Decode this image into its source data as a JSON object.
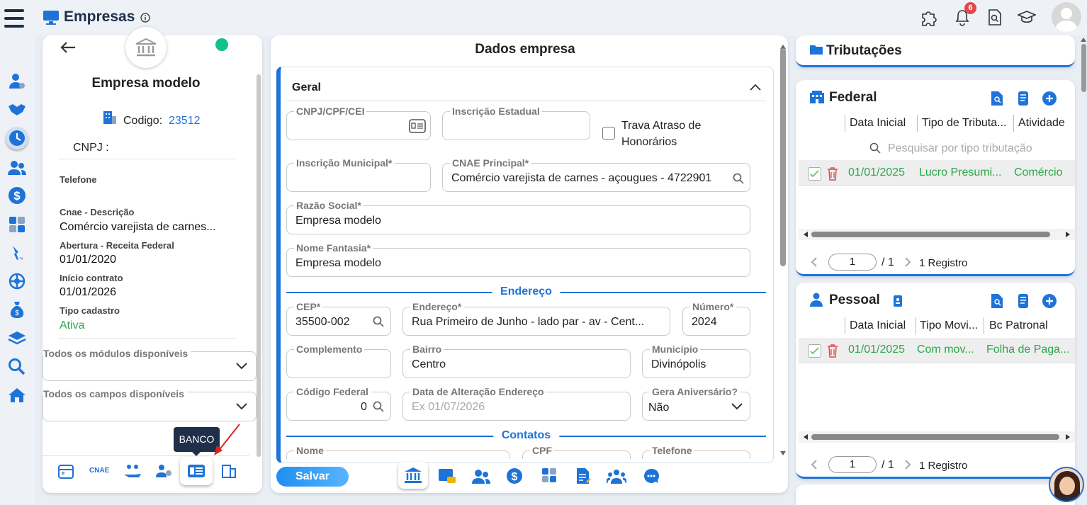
{
  "header": {
    "title": "Empresas",
    "notification_count": "6"
  },
  "company": {
    "name": "Empresa modelo",
    "codigo_label": "Codigo:",
    "codigo_value": "23512",
    "cnpj_label": "CNPJ :",
    "telefone_label": "Telefone",
    "cnae_label": "Cnae - Descrição",
    "cnae_value": "Comércio varejista de carnes...",
    "abertura_label": "Abertura - Receita Federal",
    "abertura_value": "01/01/2020",
    "inicio_label": "Início contrato",
    "inicio_value": "01/01/2026",
    "tipo_label": "Tipo cadastro",
    "tipo_value": "Ativa",
    "modulos_label": "Todos os módulos disponíveis",
    "campos_label": "Todos os campos disponíveis",
    "tooltip": "BANCO",
    "cnae_tab": "CNAE"
  },
  "colors": {
    "accent": "#1e73d8",
    "green": "#2aa84a",
    "status_dot": "#10c28a",
    "tooltip_bg": "#1f2f4a"
  },
  "form": {
    "title": "Dados empresa",
    "section_geral": "Geral",
    "cnpj_label": "CNPJ/CPF/CEI",
    "ie_label": "Inscrição Estadual",
    "trava_label": "Trava Atraso de Honorários",
    "im_label": "Inscrição Municipal*",
    "cnae_label": "CNAE Principal*",
    "cnae_value": "Comércio varejista de carnes - açougues - 4722901",
    "razao_label": "Razão Social*",
    "razao_value": "Empresa modelo",
    "fantasia_label": "Nome Fantasia*",
    "fantasia_value": "Empresa modelo",
    "endereco_section": "Endereço",
    "cep_label": "CEP*",
    "cep_value": "35500-002",
    "endereco_label": "Endereço*",
    "endereco_value": "Rua Primeiro de Junho - lado par - av - Cent...",
    "numero_label": "Número*",
    "numero_value": "2024",
    "complemento_label": "Complemento",
    "bairro_label": "Bairro",
    "bairro_value": "Centro",
    "municipio_label": "Município",
    "municipio_value": "Divinópolis",
    "codfed_label": "Código Federal",
    "codfed_value": "0",
    "dataalt_label": "Data de Alteração Endereço",
    "dataalt_placeholder": "Ex 01/07/2026",
    "gera_label": "Gera Aniversário?",
    "gera_value": "Não",
    "contatos_section": "Contatos",
    "nome_label": "Nome",
    "cpf_label": "CPF",
    "telefone_label": "Telefone",
    "salvar": "Salvar"
  },
  "tributacoes": {
    "title": "Tributações",
    "federal": {
      "title": "Federal",
      "columns": [
        "Data Inicial",
        "Tipo de Tributa...",
        "Atividade"
      ],
      "search_placeholder": "Pesquisar por tipo tributação",
      "row": [
        "01/01/2025",
        "Lucro Presumi...",
        "Comércio"
      ],
      "page": "1",
      "page_total": "/ 1",
      "registros": "1 Registro"
    },
    "pessoal": {
      "title": "Pessoal",
      "columns": [
        "Data Inicial",
        "Tipo Movi...",
        "Bc Patronal"
      ],
      "row": [
        "01/01/2025",
        "Com mov...",
        "Folha de Paga..."
      ],
      "page": "1",
      "page_total": "/ 1",
      "registros": "1 Registro"
    }
  }
}
